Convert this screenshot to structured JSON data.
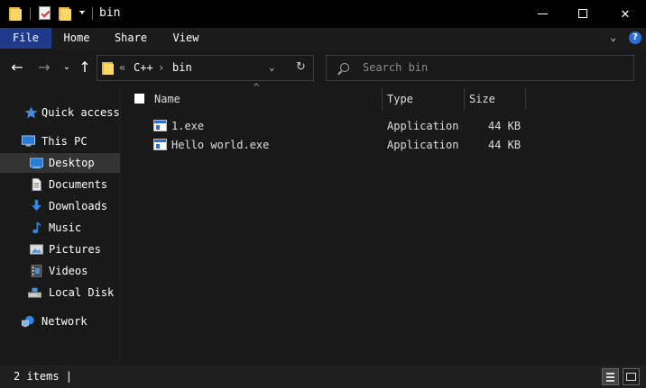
{
  "window": {
    "title": "bin",
    "quick_access_toolbar": [
      "folder-icon",
      "properties-icon",
      "new-folder-icon",
      "customize-dropdown"
    ],
    "controls": {
      "minimize": "—",
      "maximize": "☐",
      "close": "✕"
    }
  },
  "ribbon": {
    "tabs": [
      "File",
      "Home",
      "Share",
      "View"
    ],
    "active_tab": "File",
    "collapse_glyph": "⌄",
    "help_glyph": "?",
    "accent_color": "#1f3a8a"
  },
  "navigation": {
    "back_glyph": "←",
    "forward_glyph": "→",
    "recent_glyph": "⌄",
    "up_glyph": "↑",
    "address": {
      "overflow": "«",
      "crumbs": [
        "C++",
        "bin"
      ],
      "separator": "›",
      "dropdown_glyph": "⌄",
      "refresh_glyph": "↻"
    },
    "search": {
      "placeholder": "Search bin"
    }
  },
  "sidebar": {
    "items": [
      {
        "label": "Quick access",
        "icon": "star-icon"
      },
      {
        "label": "This PC",
        "icon": "computer-icon"
      },
      {
        "label": "Desktop",
        "icon": "desktop-icon",
        "selected": true
      },
      {
        "label": "Documents",
        "icon": "documents-icon"
      },
      {
        "label": "Downloads",
        "icon": "downloads-icon"
      },
      {
        "label": "Music",
        "icon": "music-icon"
      },
      {
        "label": "Pictures",
        "icon": "pictures-icon"
      },
      {
        "label": "Videos",
        "icon": "videos-icon"
      },
      {
        "label": "Local Disk",
        "icon": "drive-icon"
      },
      {
        "label": "Network",
        "icon": "network-icon"
      }
    ]
  },
  "file_list": {
    "sort_glyph": "^",
    "columns": [
      "Name",
      "Type",
      "Size"
    ],
    "rows": [
      {
        "name": "1.exe",
        "type": "Application",
        "size": "44 KB",
        "icon": "application-icon"
      },
      {
        "name": "Hello world.exe",
        "type": "Application",
        "size": "44 KB",
        "icon": "application-icon"
      }
    ]
  },
  "status": {
    "text": "2 items |"
  }
}
